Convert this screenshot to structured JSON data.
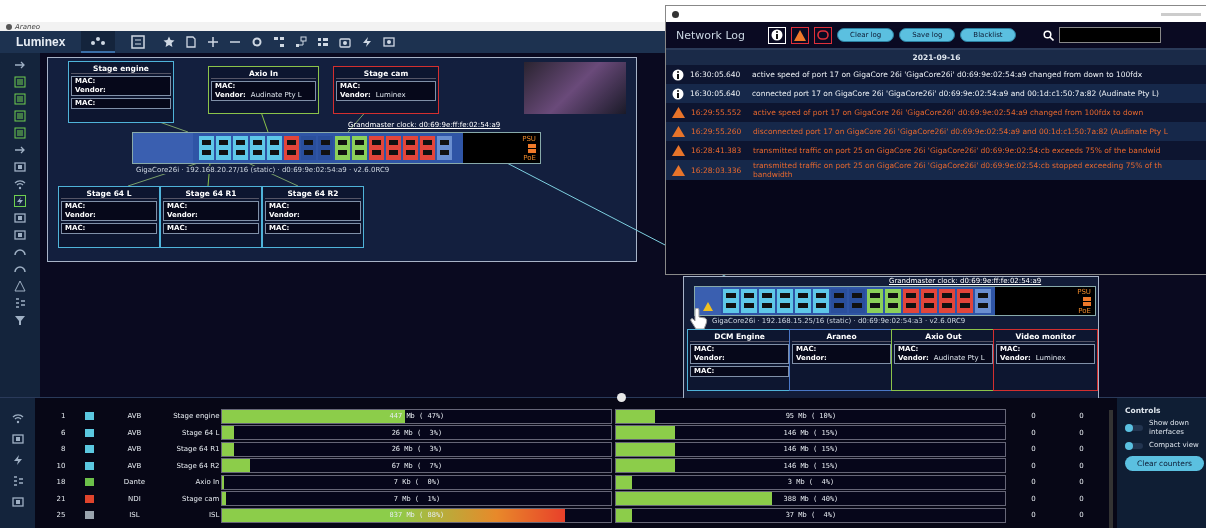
{
  "app": {
    "title": "Araneo",
    "brand": "Luminex",
    "tabs": [
      {
        "selected": true
      },
      {
        "selected": false
      }
    ]
  },
  "topologies": [
    {
      "grandmaster": "Grandmaster clock: d0:69:9e:ff:fe:02:54:a9",
      "switch_label": "GigaCore26i · 192.168.20.27/16 (static) · d0:69:9e:02:54:a9 · v2.6.0RC9",
      "psu": "PSU",
      "poe": "PoE",
      "ports": [
        {
          "color": "#5ec8e8"
        },
        {
          "color": "#5ec8e8"
        },
        {
          "color": "#5ec8e8"
        },
        {
          "color": "#5ec8e8"
        },
        {
          "color": "#5ec8e8"
        },
        {
          "color": "#e2453a"
        },
        {
          "color": "#2a4f9c"
        },
        {
          "color": "#2a4f9c"
        },
        {
          "color": "#8bd05a"
        },
        {
          "color": "#8bd05a"
        },
        {
          "color": "#e2453a"
        },
        {
          "color": "#e2453a"
        },
        {
          "color": "#e2453a"
        },
        {
          "color": "#e2453a"
        },
        {
          "color": "#6a8fd0"
        }
      ],
      "nodes": [
        {
          "title": "Stage engine",
          "color": "#4fb3d9",
          "fields": [
            {
              "label": "MAC:"
            },
            {
              "label": "Vendor:"
            }
          ],
          "extra": [
            {
              "label": "MAC:"
            }
          ]
        },
        {
          "title": "Axio In",
          "color": "#8bc34a",
          "fields": [
            {
              "label": "MAC:"
            },
            {
              "label": "Vendor:",
              "value": "Audinate Pty L"
            }
          ]
        },
        {
          "title": "Stage cam",
          "color": "#d32f2f",
          "fields": [
            {
              "label": "MAC:"
            },
            {
              "label": "Vendor:",
              "value": "Luminex"
            }
          ]
        },
        {
          "title": "Stage 64 L",
          "color": "#4fb3d9",
          "fields": [
            {
              "label": "MAC:"
            },
            {
              "label": "Vendor:"
            }
          ],
          "extra": [
            {
              "label": "MAC:"
            }
          ]
        },
        {
          "title": "Stage 64 R1",
          "color": "#4fb3d9",
          "fields": [
            {
              "label": "MAC:"
            },
            {
              "label": "Vendor:"
            }
          ],
          "extra": [
            {
              "label": "MAC:"
            }
          ]
        },
        {
          "title": "Stage 64 R2",
          "color": "#4fb3d9",
          "fields": [
            {
              "label": "MAC:"
            },
            {
              "label": "Vendor:"
            }
          ],
          "extra": [
            {
              "label": "MAC:"
            }
          ]
        }
      ]
    },
    {
      "grandmaster": "Grandmaster clock: d0:69:9e:ff:fe:02:54:a9",
      "switch_label": "GigaCore26i · 192.168.15.25/16 (static) · d0:69:9e:02:54:a3 · v2.6.0RC9",
      "psu": "PSU",
      "poe": "PoE",
      "ports": [
        {
          "color": "#5ec8e8"
        },
        {
          "color": "#5ec8e8"
        },
        {
          "color": "#5ec8e8"
        },
        {
          "color": "#5ec8e8"
        },
        {
          "color": "#5ec8e8"
        },
        {
          "color": "#5ec8e8"
        },
        {
          "color": "#2a4f9c"
        },
        {
          "color": "#2a4f9c"
        },
        {
          "color": "#8bd05a"
        },
        {
          "color": "#8bd05a"
        },
        {
          "color": "#e2453a"
        },
        {
          "color": "#e2453a"
        },
        {
          "color": "#e2453a"
        },
        {
          "color": "#e2453a"
        },
        {
          "color": "#6a8fd0"
        }
      ],
      "nodes": [
        {
          "title": "DCM Engine",
          "color": "#4fb3d9",
          "fields": [
            {
              "label": "MAC:"
            },
            {
              "label": "Vendor:"
            }
          ],
          "extra": [
            {
              "label": "MAC:"
            }
          ]
        },
        {
          "title": "Araneo",
          "color": "#4a78c8",
          "fields": [
            {
              "label": "MAC:"
            },
            {
              "label": "Vendor:"
            }
          ]
        },
        {
          "title": "Axio Out",
          "color": "#8bc34a",
          "fields": [
            {
              "label": "MAC:"
            },
            {
              "label": "Vendor:",
              "value": "Audinate Pty L"
            }
          ]
        },
        {
          "title": "Video monitor",
          "color": "#d32f2f",
          "fields": [
            {
              "label": "MAC:"
            },
            {
              "label": "Vendor:",
              "value": "Luminex"
            }
          ]
        }
      ]
    }
  ],
  "log": {
    "title": "Network Log",
    "buttons": [
      "Clear log",
      "Save log",
      "Blacklist"
    ],
    "date": "2021-09-16",
    "entries": [
      {
        "kind": "info",
        "time": "16:30:05.640",
        "message": "active speed of port 17 on GigaCore 26i 'GigaCore26i' d0:69:9e:02:54:a9 changed from down to 100fdx"
      },
      {
        "kind": "info",
        "time": "16:30:05.640",
        "message": "connected port 17 on GigaCore 26i 'GigaCore26i' d0:69:9e:02:54:a9 and 00:1d:c1:50:7a:82 (Audinate Pty L)"
      },
      {
        "kind": "warning",
        "time": "16:29:55.552",
        "message": "active speed of port 17 on GigaCore 26i 'GigaCore26i' d0:69:9e:02:54:a9 changed from 100fdx to down"
      },
      {
        "kind": "warning",
        "time": "16:29:55.260",
        "message": "disconnected port 17 on GigaCore 26i 'GigaCore26i' d0:69:9e:02:54:a9 and 00:1d:c1:50:7a:82 (Audinate Pty L"
      },
      {
        "kind": "warning",
        "time": "16:28:41.383",
        "message": "transmitted traffic on port 25 on GigaCore 26i 'GigaCore26i' d0:69:9e:02:54:cb exceeds 75% of the bandwid"
      },
      {
        "kind": "warning",
        "time": "16:28:03.336",
        "message": "transmitted traffic on port 25 on GigaCore 26i 'GigaCore26i' d0:69:9e:02:54:cb stopped exceeding 75% of th bandwidth"
      }
    ]
  },
  "ports": [
    {
      "port": "1",
      "color": "#5bc8e0",
      "protocol": "AVB",
      "name": "Stage engine",
      "tx": {
        "level": 0.47,
        "reading": "447 Mb ( 47%)"
      },
      "rx": {
        "level": 0.1,
        "reading": "95 Mb ( 10%)"
      },
      "c1": "0",
      "c2": "0"
    },
    {
      "port": "6",
      "color": "#5bc8e0",
      "protocol": "AVB",
      "name": "Stage 64 L",
      "tx": {
        "level": 0.03,
        "reading": "26 Mb (  3%)"
      },
      "rx": {
        "level": 0.15,
        "reading": "146 Mb ( 15%)"
      },
      "c1": "0",
      "c2": "0"
    },
    {
      "port": "8",
      "color": "#5bc8e0",
      "protocol": "AVB",
      "name": "Stage 64 R1",
      "tx": {
        "level": 0.03,
        "reading": "26 Mb (  3%)"
      },
      "rx": {
        "level": 0.15,
        "reading": "146 Mb ( 15%)"
      },
      "c1": "0",
      "c2": "0"
    },
    {
      "port": "10",
      "color": "#5bc8e0",
      "protocol": "AVB",
      "name": "Stage 64 R2",
      "tx": {
        "level": 0.07,
        "reading": "67 Mb (  7%)"
      },
      "rx": {
        "level": 0.15,
        "reading": "146 Mb ( 15%)"
      },
      "c1": "0",
      "c2": "0"
    },
    {
      "port": "18",
      "color": "#6cc04a",
      "protocol": "Dante",
      "name": "Axio In",
      "tx": {
        "level": 0,
        "reading": "7 Kb (  0%)"
      },
      "rx": {
        "level": 0.04,
        "reading": "3 Mb (  4%)"
      },
      "c1": "0",
      "c2": "0"
    },
    {
      "port": "21",
      "color": "#e0442c",
      "protocol": "NDI",
      "name": "Stage cam",
      "tx": {
        "level": 0.01,
        "reading": "7 Mb (  1%)"
      },
      "rx": {
        "level": 0.4,
        "reading": "388 Mb ( 40%)"
      },
      "c1": "0",
      "c2": "0"
    },
    {
      "port": "25",
      "color": "#9aa4ae",
      "protocol": "ISL",
      "name": "ISL",
      "tx": {
        "level": 0.88,
        "reading": "837 Mb ( 88%)"
      },
      "rx": {
        "level": 0.04,
        "reading": "37 Mb (  4%)"
      },
      "c1": "0",
      "c2": "0"
    }
  ],
  "controls": {
    "title": "Controls",
    "toggles": [
      {
        "label": "Show down interfaces",
        "on": false
      },
      {
        "label": "Compact view",
        "on": false
      }
    ],
    "button": "Clear counters"
  }
}
